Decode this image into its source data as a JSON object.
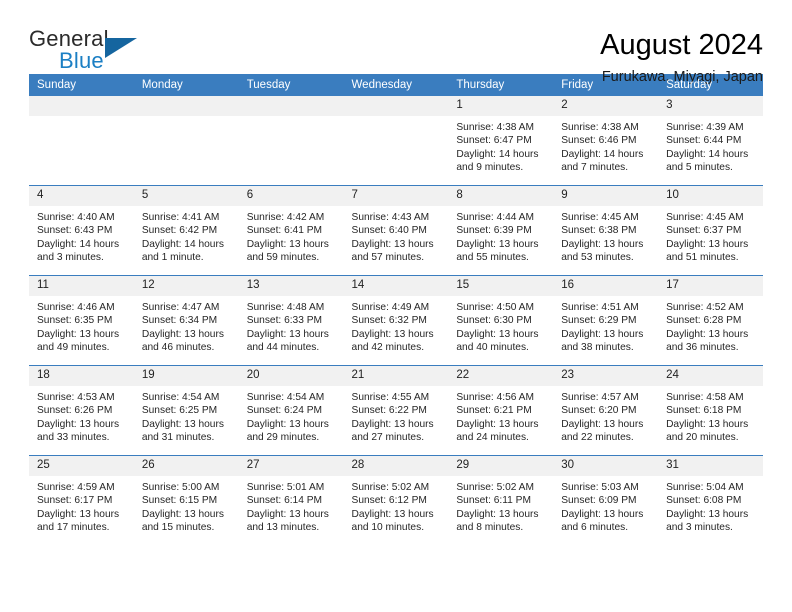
{
  "brand": {
    "name_part1": "General",
    "name_part2": "Blue",
    "triangle_color": "#15659f",
    "blue_color": "#1b7fc4"
  },
  "header": {
    "title": "August 2024",
    "subtitle": "Furukawa, Miyagi, Japan"
  },
  "theme": {
    "header_blue": "#3a7dbf",
    "daynum_bg": "#f1f1f1"
  },
  "calendar": {
    "weekday_headers": [
      "Sunday",
      "Monday",
      "Tuesday",
      "Wednesday",
      "Thursday",
      "Friday",
      "Saturday"
    ],
    "weeks": [
      [
        {
          "day": "",
          "lines": []
        },
        {
          "day": "",
          "lines": []
        },
        {
          "day": "",
          "lines": []
        },
        {
          "day": "",
          "lines": []
        },
        {
          "day": "1",
          "lines": [
            "Sunrise: 4:38 AM",
            "Sunset: 6:47 PM",
            "Daylight: 14 hours",
            "and 9 minutes."
          ]
        },
        {
          "day": "2",
          "lines": [
            "Sunrise: 4:38 AM",
            "Sunset: 6:46 PM",
            "Daylight: 14 hours",
            "and 7 minutes."
          ]
        },
        {
          "day": "3",
          "lines": [
            "Sunrise: 4:39 AM",
            "Sunset: 6:44 PM",
            "Daylight: 14 hours",
            "and 5 minutes."
          ]
        }
      ],
      [
        {
          "day": "4",
          "lines": [
            "Sunrise: 4:40 AM",
            "Sunset: 6:43 PM",
            "Daylight: 14 hours",
            "and 3 minutes."
          ]
        },
        {
          "day": "5",
          "lines": [
            "Sunrise: 4:41 AM",
            "Sunset: 6:42 PM",
            "Daylight: 14 hours",
            "and 1 minute."
          ]
        },
        {
          "day": "6",
          "lines": [
            "Sunrise: 4:42 AM",
            "Sunset: 6:41 PM",
            "Daylight: 13 hours",
            "and 59 minutes."
          ]
        },
        {
          "day": "7",
          "lines": [
            "Sunrise: 4:43 AM",
            "Sunset: 6:40 PM",
            "Daylight: 13 hours",
            "and 57 minutes."
          ]
        },
        {
          "day": "8",
          "lines": [
            "Sunrise: 4:44 AM",
            "Sunset: 6:39 PM",
            "Daylight: 13 hours",
            "and 55 minutes."
          ]
        },
        {
          "day": "9",
          "lines": [
            "Sunrise: 4:45 AM",
            "Sunset: 6:38 PM",
            "Daylight: 13 hours",
            "and 53 minutes."
          ]
        },
        {
          "day": "10",
          "lines": [
            "Sunrise: 4:45 AM",
            "Sunset: 6:37 PM",
            "Daylight: 13 hours",
            "and 51 minutes."
          ]
        }
      ],
      [
        {
          "day": "11",
          "lines": [
            "Sunrise: 4:46 AM",
            "Sunset: 6:35 PM",
            "Daylight: 13 hours",
            "and 49 minutes."
          ]
        },
        {
          "day": "12",
          "lines": [
            "Sunrise: 4:47 AM",
            "Sunset: 6:34 PM",
            "Daylight: 13 hours",
            "and 46 minutes."
          ]
        },
        {
          "day": "13",
          "lines": [
            "Sunrise: 4:48 AM",
            "Sunset: 6:33 PM",
            "Daylight: 13 hours",
            "and 44 minutes."
          ]
        },
        {
          "day": "14",
          "lines": [
            "Sunrise: 4:49 AM",
            "Sunset: 6:32 PM",
            "Daylight: 13 hours",
            "and 42 minutes."
          ]
        },
        {
          "day": "15",
          "lines": [
            "Sunrise: 4:50 AM",
            "Sunset: 6:30 PM",
            "Daylight: 13 hours",
            "and 40 minutes."
          ]
        },
        {
          "day": "16",
          "lines": [
            "Sunrise: 4:51 AM",
            "Sunset: 6:29 PM",
            "Daylight: 13 hours",
            "and 38 minutes."
          ]
        },
        {
          "day": "17",
          "lines": [
            "Sunrise: 4:52 AM",
            "Sunset: 6:28 PM",
            "Daylight: 13 hours",
            "and 36 minutes."
          ]
        }
      ],
      [
        {
          "day": "18",
          "lines": [
            "Sunrise: 4:53 AM",
            "Sunset: 6:26 PM",
            "Daylight: 13 hours",
            "and 33 minutes."
          ]
        },
        {
          "day": "19",
          "lines": [
            "Sunrise: 4:54 AM",
            "Sunset: 6:25 PM",
            "Daylight: 13 hours",
            "and 31 minutes."
          ]
        },
        {
          "day": "20",
          "lines": [
            "Sunrise: 4:54 AM",
            "Sunset: 6:24 PM",
            "Daylight: 13 hours",
            "and 29 minutes."
          ]
        },
        {
          "day": "21",
          "lines": [
            "Sunrise: 4:55 AM",
            "Sunset: 6:22 PM",
            "Daylight: 13 hours",
            "and 27 minutes."
          ]
        },
        {
          "day": "22",
          "lines": [
            "Sunrise: 4:56 AM",
            "Sunset: 6:21 PM",
            "Daylight: 13 hours",
            "and 24 minutes."
          ]
        },
        {
          "day": "23",
          "lines": [
            "Sunrise: 4:57 AM",
            "Sunset: 6:20 PM",
            "Daylight: 13 hours",
            "and 22 minutes."
          ]
        },
        {
          "day": "24",
          "lines": [
            "Sunrise: 4:58 AM",
            "Sunset: 6:18 PM",
            "Daylight: 13 hours",
            "and 20 minutes."
          ]
        }
      ],
      [
        {
          "day": "25",
          "lines": [
            "Sunrise: 4:59 AM",
            "Sunset: 6:17 PM",
            "Daylight: 13 hours",
            "and 17 minutes."
          ]
        },
        {
          "day": "26",
          "lines": [
            "Sunrise: 5:00 AM",
            "Sunset: 6:15 PM",
            "Daylight: 13 hours",
            "and 15 minutes."
          ]
        },
        {
          "day": "27",
          "lines": [
            "Sunrise: 5:01 AM",
            "Sunset: 6:14 PM",
            "Daylight: 13 hours",
            "and 13 minutes."
          ]
        },
        {
          "day": "28",
          "lines": [
            "Sunrise: 5:02 AM",
            "Sunset: 6:12 PM",
            "Daylight: 13 hours",
            "and 10 minutes."
          ]
        },
        {
          "day": "29",
          "lines": [
            "Sunrise: 5:02 AM",
            "Sunset: 6:11 PM",
            "Daylight: 13 hours",
            "and 8 minutes."
          ]
        },
        {
          "day": "30",
          "lines": [
            "Sunrise: 5:03 AM",
            "Sunset: 6:09 PM",
            "Daylight: 13 hours",
            "and 6 minutes."
          ]
        },
        {
          "day": "31",
          "lines": [
            "Sunrise: 5:04 AM",
            "Sunset: 6:08 PM",
            "Daylight: 13 hours",
            "and 3 minutes."
          ]
        }
      ]
    ]
  }
}
